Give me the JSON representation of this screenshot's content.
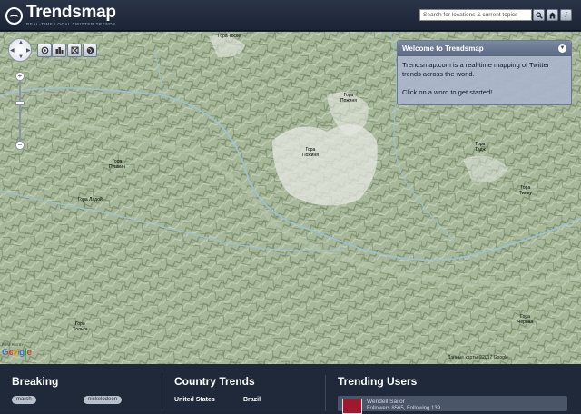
{
  "header": {
    "logo_title": "Trendsmap",
    "logo_tagline": "REAL-TIME LOCAL TWITTER TRENDS",
    "search_placeholder": "Search for locations & current topics",
    "search_icon": "magnifier-icon",
    "home_icon": "home-icon",
    "info_label": "i"
  },
  "map": {
    "toolbar_icons": [
      "locate-icon",
      "city-icon",
      "layers-icon",
      "globe-icon"
    ],
    "zoom_in": "+",
    "zoom_out": "−",
    "labels": [
      {
        "name": "Гора",
        "sub": "Пожиня"
      },
      {
        "name": "Гора",
        "sub": "Пожиня"
      },
      {
        "name": "Гора",
        "sub": "Пушкин"
      },
      {
        "name": "Гора",
        "sub": "Тадж"
      },
      {
        "name": "Гора",
        "sub": "Тилеу"
      },
      {
        "name": "Гора Ладой",
        "sub": ""
      },
      {
        "name": "Гора Тоске",
        "sub": ""
      },
      {
        "name": "Гора",
        "sub": "Холька"
      },
      {
        "name": "Гора",
        "sub": "Черная"
      }
    ],
    "google_brand": "Google",
    "powered_by": "POWERED BY",
    "copyright": "Данные карты ©2017 Google"
  },
  "welcome": {
    "title": "Welcome to Trendsmap",
    "close_icon": "collapse-icon",
    "body_1": "Trendsmap.com is a real-time mapping of Twitter trends across the world.",
    "body_2": "Click on a word to get started!"
  },
  "bottom": {
    "breaking": {
      "title": "Breaking",
      "chips": [
        "marsh",
        "nickelodeon"
      ]
    },
    "country_trends": {
      "title": "Country Trends",
      "countries": [
        "United States",
        "Brazil"
      ]
    },
    "trending_users": {
      "title": "Trending Users",
      "user_name": "Wendell Sailor",
      "user_stats": "Followers 8565, Following 139"
    }
  },
  "colors": {
    "header_bg": "#1c2535",
    "footer_bg": "#1f2939",
    "panel_header": "#5b6882",
    "map_green": "#a8b79b"
  }
}
